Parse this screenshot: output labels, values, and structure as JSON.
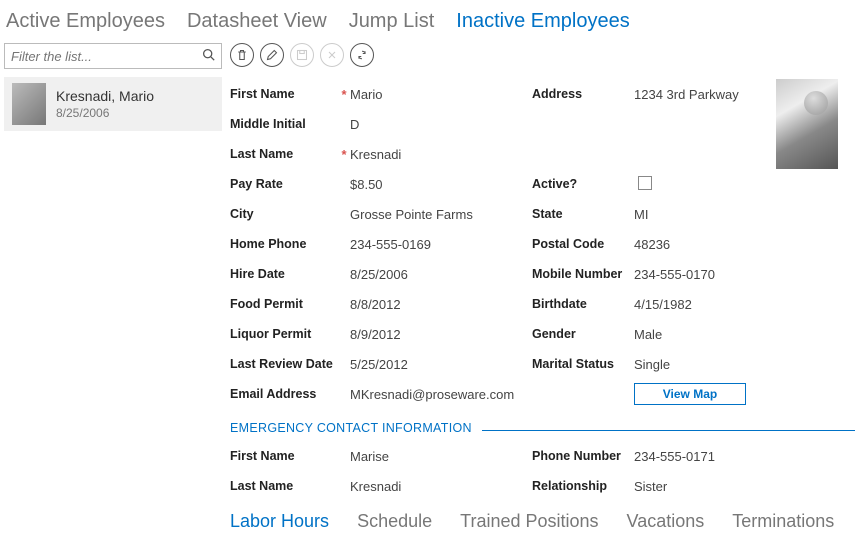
{
  "tabs": [
    "Active Employees",
    "Datasheet View",
    "Jump List",
    "Inactive Employees"
  ],
  "active_tab": 3,
  "search": {
    "placeholder": "Filter the list..."
  },
  "list": [
    {
      "name": "Kresnadi, Mario",
      "date": "8/25/2006"
    }
  ],
  "labels": {
    "first_name": "First Name",
    "middle_initial": "Middle Initial",
    "last_name": "Last Name",
    "pay_rate": "Pay Rate",
    "city": "City",
    "home_phone": "Home Phone",
    "hire_date": "Hire Date",
    "food_permit": "Food Permit",
    "liquor_permit": "Liquor Permit",
    "last_review": "Last Review Date",
    "email": "Email Address",
    "address": "Address",
    "active": "Active?",
    "state": "State",
    "postal": "Postal Code",
    "mobile": "Mobile Number",
    "birthdate": "Birthdate",
    "gender": "Gender",
    "marital": "Marital Status",
    "phone_number": "Phone Number",
    "relationship": "Relationship",
    "view_map": "View Map",
    "emergency": "EMERGENCY CONTACT INFORMATION"
  },
  "employee": {
    "first_name": "Mario",
    "middle_initial": "D",
    "last_name": "Kresnadi",
    "pay_rate": "$8.50",
    "city": "Grosse Pointe Farms",
    "home_phone": "234-555-0169",
    "hire_date": "8/25/2006",
    "food_permit": "8/8/2012",
    "liquor_permit": "8/9/2012",
    "last_review": "5/25/2012",
    "email": "MKresnadi@proseware.com",
    "address": "1234 3rd Parkway",
    "active": false,
    "state": "MI",
    "postal": "48236",
    "mobile": "234-555-0170",
    "birthdate": "4/15/1982",
    "gender": "Male",
    "marital": "Single"
  },
  "emergency": {
    "first_name": "Marise",
    "last_name": "Kresnadi",
    "phone": "234-555-0171",
    "relationship": "Sister"
  },
  "bottom_tabs": [
    "Labor Hours",
    "Schedule",
    "Trained Positions",
    "Vacations",
    "Terminations"
  ],
  "active_bottom_tab": 0
}
